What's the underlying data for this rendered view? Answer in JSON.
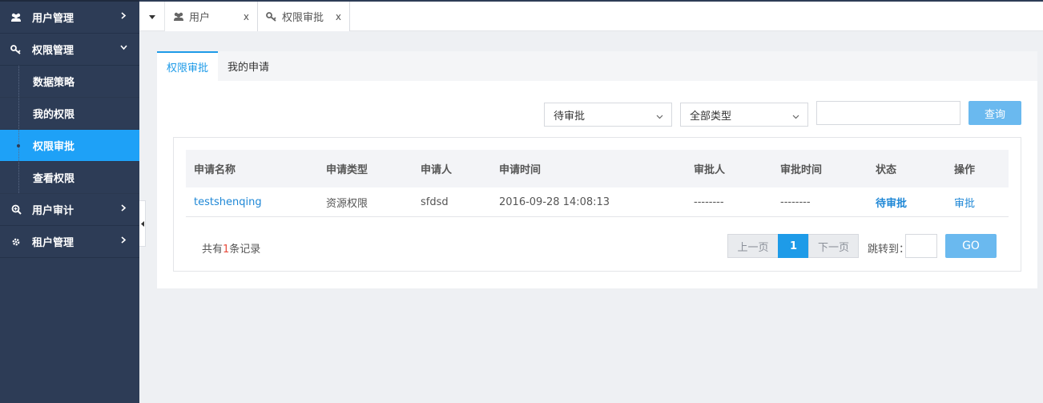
{
  "sidebar": {
    "items": [
      {
        "label": "用户管理",
        "icon": "users-icon"
      },
      {
        "label": "权限管理",
        "icon": "key-icon"
      },
      {
        "label": "用户审计",
        "icon": "search-plus-icon"
      },
      {
        "label": "租户管理",
        "icon": "gear-icon"
      }
    ],
    "subitems": [
      {
        "label": "数据策略"
      },
      {
        "label": "我的权限"
      },
      {
        "label": "权限审批"
      },
      {
        "label": "查看权限"
      }
    ]
  },
  "tabs": [
    {
      "label": "用户",
      "close": "x"
    },
    {
      "label": "权限审批",
      "close": "x"
    }
  ],
  "inner_tabs": [
    "权限审批",
    "我的申请"
  ],
  "filters": {
    "status_select": "待审批",
    "type_select": "全部类型",
    "search_value": "",
    "search_button": "查询"
  },
  "table": {
    "headers": [
      "申请名称",
      "申请类型",
      "申请人",
      "申请时间",
      "审批人",
      "审批时间",
      "状态",
      "操作"
    ],
    "rows": [
      [
        "testshenqing",
        "资源权限",
        "sfdsd",
        "2016-09-28 14:08:13",
        "--------",
        "--------",
        "待审批",
        "审批"
      ]
    ]
  },
  "pagination": {
    "count_prefix": "共有",
    "count": "1",
    "count_suffix": "条记录",
    "prev": "上一页",
    "current": "1",
    "next": "下一页",
    "jump_label": "跳转到：",
    "go": "GO"
  },
  "colors": {
    "sidebar_bg": "#2d3c56",
    "active": "#1ea1f7",
    "link": "#1e87d6",
    "button": "#6ab9ef"
  }
}
